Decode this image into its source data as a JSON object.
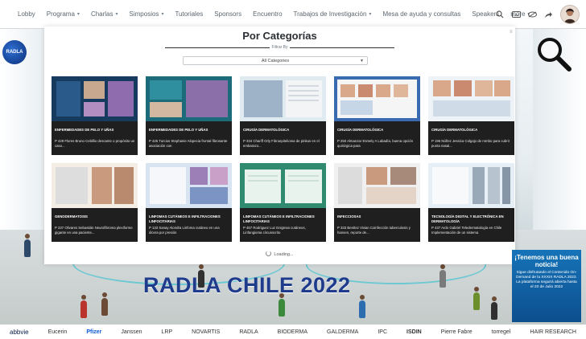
{
  "nav": {
    "items": [
      {
        "label": "Lobby",
        "dropdown": false
      },
      {
        "label": "Programa",
        "dropdown": true
      },
      {
        "label": "Charlas",
        "dropdown": true
      },
      {
        "label": "Simposios",
        "dropdown": true
      },
      {
        "label": "Tutoriales",
        "dropdown": false
      },
      {
        "label": "Sponsors",
        "dropdown": false
      },
      {
        "label": "Encuentro",
        "dropdown": false
      },
      {
        "label": "Trabajos de Investigación",
        "dropdown": true
      },
      {
        "label": "Mesa de ayuda y consultas",
        "dropdown": false
      },
      {
        "label": "Speakers",
        "dropdown": false
      },
      {
        "label": "more",
        "dropdown": true
      }
    ],
    "icons": [
      "search-icon",
      "keyboard-icon",
      "eye-off-icon",
      "share-icon"
    ]
  },
  "modal": {
    "title": "Por Categorías",
    "filter_label": "Filtrar By",
    "filter_value": "All Categories",
    "loading": "Loading..."
  },
  "cards": [
    {
      "category": "ENFERMEDADES DE PELO Y UÑAS",
      "title": "P 429 Flores Bruno Cebillio descante o propósito un caso...",
      "theme": "pelo1"
    },
    {
      "category": "ENFERMEDADES DE PELO Y UÑAS",
      "title": "P 425 Turcios Stephanie Alopecia frontal fibrosante asociación con",
      "theme": "pelo2"
    },
    {
      "category": "CIRUGÍA DERMATOLÓGICA",
      "title": "P 334 Chariff Orly Fibroepitelioma de pinkus en el embarazo...",
      "theme": "cir1"
    },
    {
      "category": "CIRUGÍA DERMATOLÓGICA",
      "title": "P 250 Almanzar Esmely A Labadía, buena opción quirúrgica para",
      "theme": "cir2"
    },
    {
      "category": "CIRUGÍA DERMATOLÓGICA",
      "title": "P 196 Núñez Jessica Colgajo de rombo para cubrir punta nasal...",
      "theme": "cir3"
    },
    {
      "category": "GENODERMATOSIS",
      "title": "P 237 Olivares Sebastián Neurofibroma plexiforme gigante en una paciente...",
      "theme": "gen"
    },
    {
      "category": "LINFOMAS CUTÁNEOS E INFILTRACIONES LINFOCITARIAS",
      "title": "P 133 Sanay Alondra Linfoma cutáneo en una úlcera por presión",
      "theme": "lin1"
    },
    {
      "category": "LINFOMAS CUTÁNEOS E INFILTRACIONES LINFOCITARIAS",
      "title": "P 457 Rodriguez Luz Enigmas cutáneos, Linfangioma circunscrito",
      "theme": "lin2"
    },
    {
      "category": "INFECCIOSAS",
      "title": "P 333 Benítez Vivian Coinfección tuberculosis y hansen, reporte de...",
      "theme": "inf"
    },
    {
      "category": "TECNOLOGÍA DIGITAL Y ELECTRÓNICA EN DERMATOLOGÍA",
      "title": "P 437 Ardo Gabriel Teledermatología en Chile Implementación de un sistema",
      "theme": "tec"
    }
  ],
  "banner": {
    "text": "RADLA CHILE 2022"
  },
  "logo_text": "RADLA",
  "ad": {
    "headline": "¡Tenemos una buena noticia!",
    "body": "Sigue disfrutando el Contenido On-Demand de la XXXIX RADLA 2022. La plataforma seguirá abierta hasta el 20 de Julio 2022"
  },
  "sponsors": [
    "abbvie",
    "Eucerin",
    "Pfizer",
    "Janssen",
    "LRP",
    "NOVARTIS",
    "RADLA",
    "BIODERMA",
    "GALDERMA",
    "IPC",
    "ISDIN",
    "Pierre Fabre",
    "torregel",
    "HAIR RESEARCH"
  ],
  "colors": {
    "accent": "#1f3b8c",
    "card_bg": "#1f1f1f",
    "ad_bg": "#1673b8"
  }
}
